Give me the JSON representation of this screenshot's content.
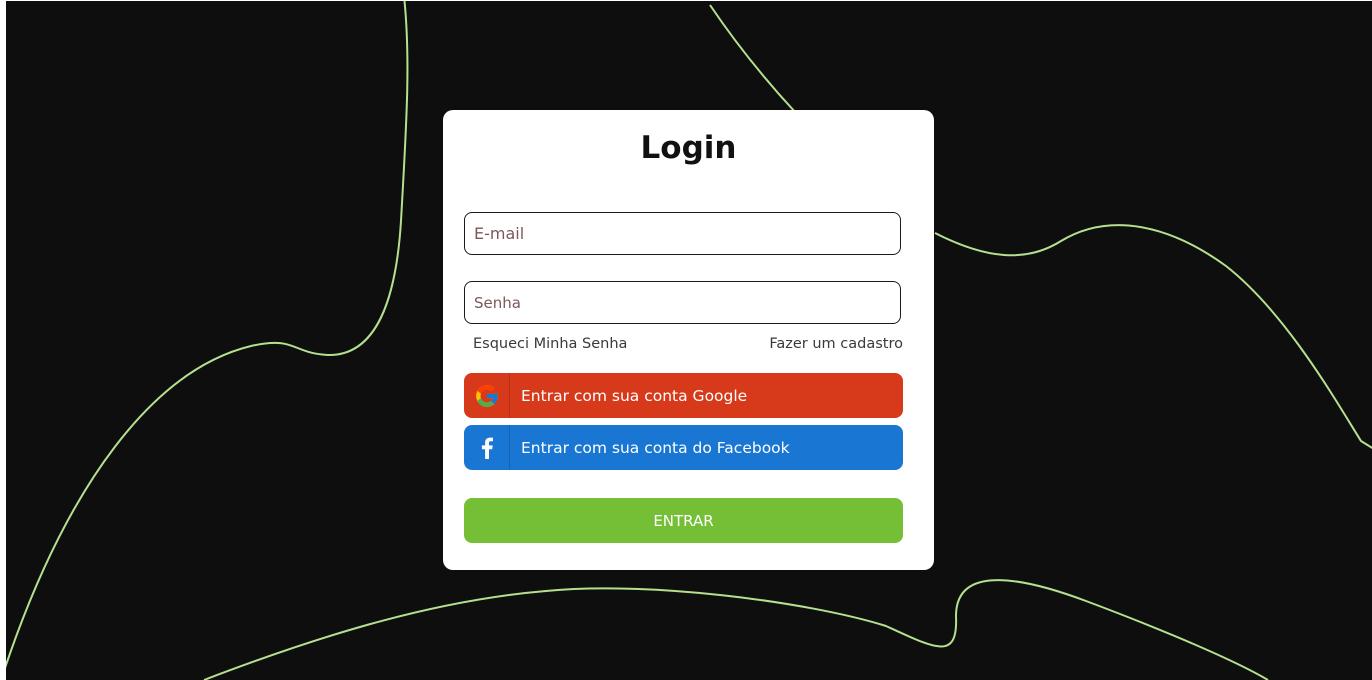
{
  "theme": {
    "background": "#0e0e0e",
    "curve_color": "#b5e08f",
    "card": "#ffffff",
    "google_color": "#d73a1b",
    "facebook_color": "#1976d2",
    "submit_color": "#74bf36"
  },
  "login": {
    "title": "Login",
    "email_placeholder": "E-mail",
    "password_placeholder": "Senha",
    "forgot_password": "Esqueci Minha Senha",
    "signup": "Fazer um cadastro",
    "google_label": "Entrar com sua conta Google",
    "google_icon": "google-icon",
    "facebook_label": "Entrar com sua conta do Facebook",
    "facebook_icon": "facebook-icon",
    "submit_label": "ENTRAR"
  }
}
